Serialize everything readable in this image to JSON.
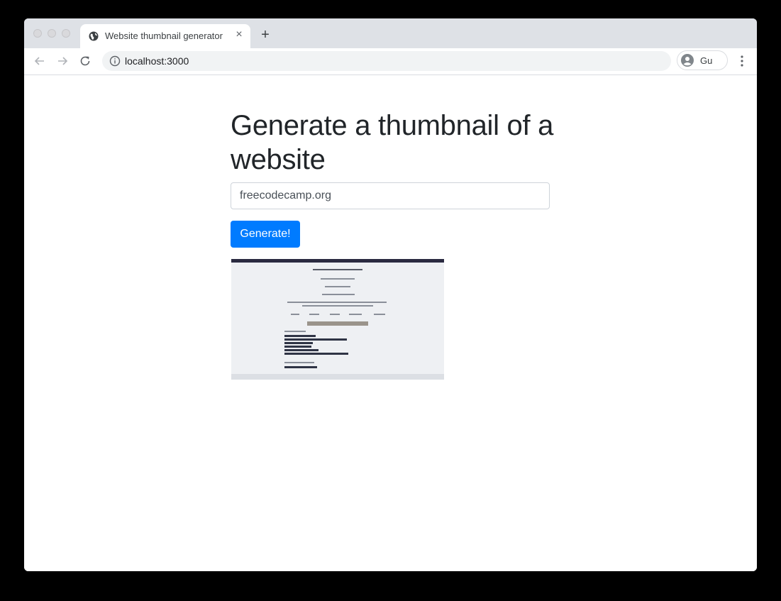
{
  "browser": {
    "tab_title": "Website thumbnail generator",
    "tab_close": "×",
    "new_tab": "+",
    "url": "localhost:3000",
    "profile_name": "Gu"
  },
  "page": {
    "heading": "Generate a thumbnail of a website",
    "input_value": "freecodecamp.org",
    "button_label": "Generate!",
    "thumbnail_alt": "thumbnail-image"
  },
  "colors": {
    "primary": "#007bff",
    "heading": "#212529"
  }
}
